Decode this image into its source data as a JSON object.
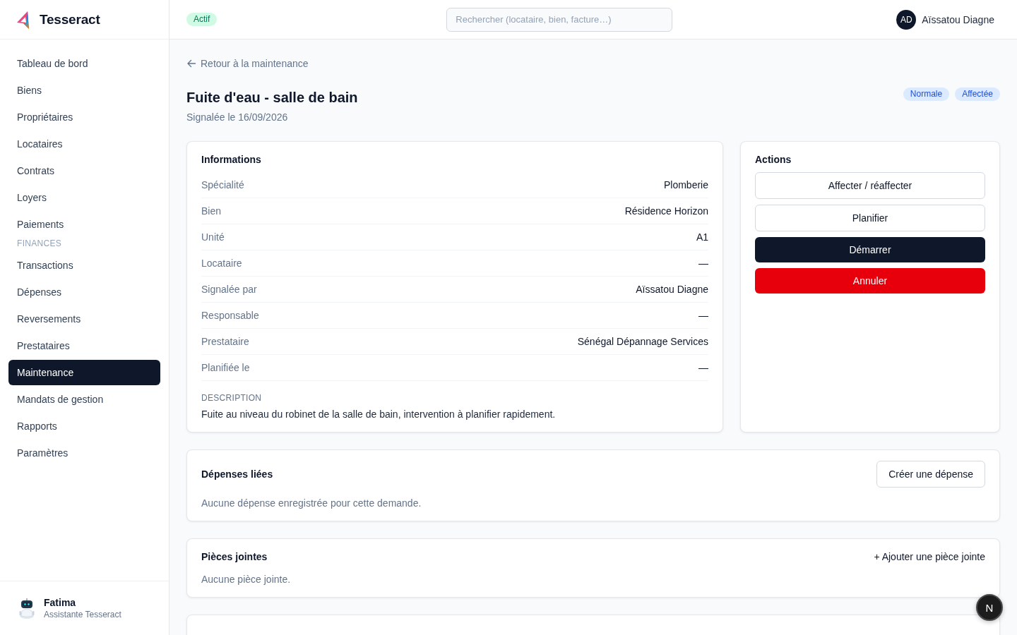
{
  "app": {
    "name": "Tesseract"
  },
  "sidebar": {
    "sections": [
      {
        "items": [
          {
            "label": "Tableau de bord",
            "selected": false
          },
          {
            "label": "Biens",
            "selected": false
          },
          {
            "label": "Propriétaires",
            "selected": false
          },
          {
            "label": "Locataires",
            "selected": false
          },
          {
            "label": "Contrats",
            "selected": false
          },
          {
            "label": "Loyers",
            "selected": false
          },
          {
            "label": "Paiements",
            "selected": false
          }
        ]
      },
      {
        "title": "FINANCES",
        "items": [
          {
            "label": "Transactions",
            "selected": false
          },
          {
            "label": "Dépenses",
            "selected": false
          },
          {
            "label": "Reversements",
            "selected": false
          },
          {
            "label": "Prestataires",
            "selected": false
          },
          {
            "label": "Maintenance",
            "selected": true
          },
          {
            "label": "Mandats de gestion",
            "selected": false
          },
          {
            "label": "Rapports",
            "selected": false
          },
          {
            "label": "Paramètres",
            "selected": false
          }
        ]
      }
    ],
    "assistant": {
      "name": "Fatima",
      "role": "Assistante Tesseract"
    }
  },
  "topbar": {
    "status_badge": "Actif",
    "search": {
      "placeholder": "Rechercher (locataire, bien, facture…)"
    },
    "user": {
      "initials": "AD",
      "name": "Aïssatou Diagne"
    }
  },
  "page": {
    "back_link": "Retour à la maintenance",
    "title": "Fuite d'eau - salle de bain",
    "subtitle": "Signalée le 16/09/2026",
    "badges": [
      "Normale",
      "Affectée"
    ]
  },
  "informations": {
    "title": "Informations",
    "rows": [
      {
        "label": "Spécialité",
        "value": "Plomberie"
      },
      {
        "label": "Bien",
        "value": "Résidence Horizon"
      },
      {
        "label": "Unité",
        "value": "A1"
      },
      {
        "label": "Locataire",
        "value": "—"
      },
      {
        "label": "Signalée par",
        "value": "Aïssatou Diagne"
      },
      {
        "label": "Responsable",
        "value": "—"
      },
      {
        "label": "Prestataire",
        "value": "Sénégal Dépannage Services"
      },
      {
        "label": "Planifiée le",
        "value": "—"
      }
    ],
    "description": {
      "label": "DESCRIPTION",
      "text": "Fuite au niveau du robinet de la salle de bain, intervention à planifier rapidement."
    }
  },
  "actions": {
    "title": "Actions",
    "buttons": [
      {
        "label": "Affecter / réaffecter",
        "kind": "outline"
      },
      {
        "label": "Planifier",
        "kind": "outline"
      },
      {
        "label": "Démarrer",
        "kind": "primary"
      },
      {
        "label": "Annuler",
        "kind": "danger"
      }
    ]
  },
  "expenses": {
    "title": "Dépenses liées",
    "button": "Créer une dépense",
    "empty_text": "Aucune dépense enregistrée pour cette demande."
  },
  "attachments": {
    "title": "Pièces jointes",
    "link": "+ Ajouter une pièce jointe",
    "empty_text": "Aucune pièce jointe."
  },
  "floating_button": {
    "label": "N"
  }
}
